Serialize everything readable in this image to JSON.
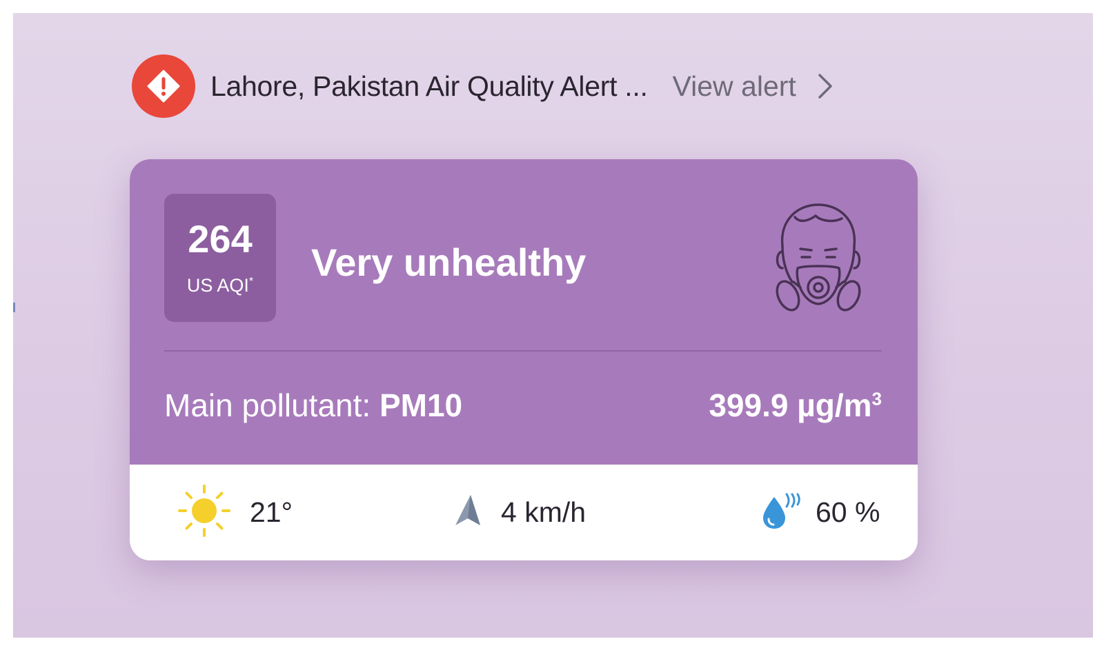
{
  "alert": {
    "icon": "warning-diamond-icon",
    "icon_color": "#e8473a",
    "title": "Lahore, Pakistan Air Quality Alert ...",
    "view_label": "View alert",
    "chevron_icon": "chevron-right-icon"
  },
  "aqi": {
    "value": "264",
    "unit_label": "US AQI",
    "unit_mark": "*",
    "level": "Very unhealthy",
    "level_color": "#a77bbb",
    "icon": "gas-mask-person-icon"
  },
  "pollutant": {
    "label": "Main pollutant:",
    "name": "PM10",
    "concentration": "399.9 µg/m",
    "concentration_exp": "3"
  },
  "weather": {
    "temperature": "21°",
    "temperature_icon": "sun-icon",
    "wind": "4 km/h",
    "wind_icon": "wind-direction-arrow-icon",
    "humidity": "60 %",
    "humidity_icon": "humidity-drop-icon"
  }
}
